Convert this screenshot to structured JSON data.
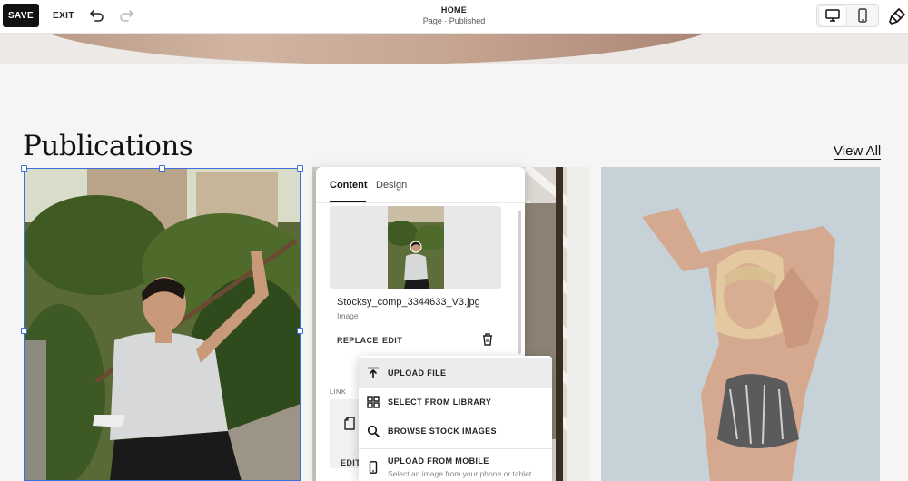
{
  "toolbar": {
    "save_label": "SAVE",
    "exit_label": "EXIT",
    "undo_icon": "undo-icon",
    "redo_icon": "redo-icon",
    "page_title": "HOME",
    "page_status": "Page · Published",
    "device_desktop_icon": "desktop-icon",
    "device_mobile_icon": "mobile-icon",
    "design_icon": "paintbrush-icon"
  },
  "section": {
    "title": "Publications",
    "view_all_label": "View All"
  },
  "panel": {
    "tabs": [
      {
        "label": "Content",
        "active": true
      },
      {
        "label": "Design",
        "active": false
      }
    ],
    "image": {
      "file_name": "Stocksy_comp_3344633_V3.jpg",
      "file_type": "Image",
      "replace_label": "REPLACE",
      "edit_label": "EDIT"
    },
    "link": {
      "label": "LINK",
      "edit_label": "EDIT"
    }
  },
  "dropdown": {
    "items": [
      {
        "label": "UPLOAD FILE",
        "icon": "upload-icon",
        "active": true
      },
      {
        "label": "SELECT FROM LIBRARY",
        "icon": "grid-icon",
        "active": false
      },
      {
        "label": "BROWSE STOCK IMAGES",
        "icon": "search-icon",
        "active": false
      },
      {
        "label": "UPLOAD FROM MOBILE",
        "icon": "phone-icon",
        "active": false,
        "sublabel": "Select an image from your phone or tablet"
      }
    ]
  },
  "colors": {
    "selection": "#3c6fd8",
    "save_button": "#111111",
    "page_background": "#f5f5f5"
  }
}
